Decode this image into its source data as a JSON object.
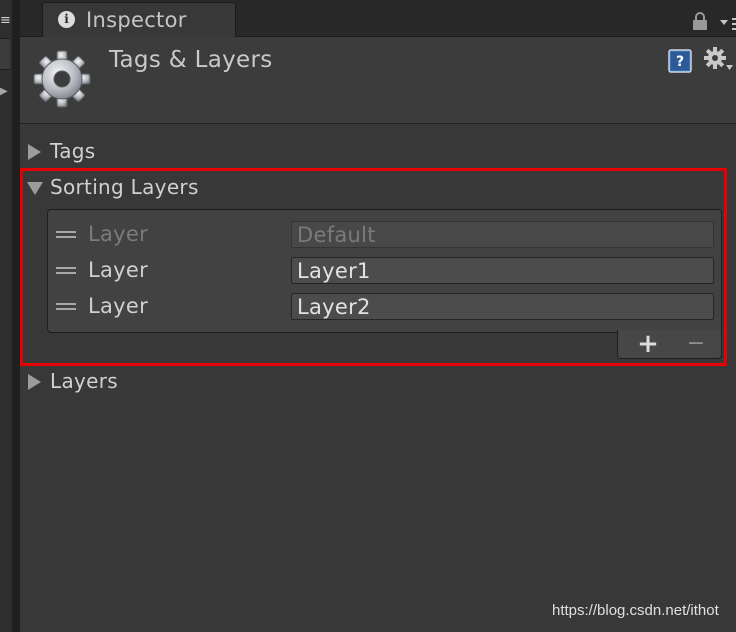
{
  "tab": {
    "title": "Inspector",
    "info_glyph": "i"
  },
  "header": {
    "title": "Tags & Layers"
  },
  "foldouts": {
    "tags": {
      "label": "Tags",
      "expanded": false
    },
    "sorting_layers": {
      "label": "Sorting Layers",
      "expanded": true
    },
    "layers": {
      "label": "Layers",
      "expanded": false
    }
  },
  "sorting_layers": {
    "items": [
      {
        "label": "Layer",
        "value": "Default",
        "disabled": true
      },
      {
        "label": "Layer",
        "value": "Layer1",
        "disabled": false
      },
      {
        "label": "Layer",
        "value": "Layer2",
        "disabled": false
      }
    ],
    "add_glyph": "+",
    "remove_glyph": "−"
  },
  "left_strip": {
    "menu_glyph": "≡",
    "arrow_glyph": "▶"
  },
  "icons": {
    "info": "info-icon",
    "lock": "lock-icon",
    "tab_menu": "tab-menu-icon",
    "gear": "gear-icon",
    "help": "help-icon",
    "settings": "settings-icon",
    "drag_handle": "drag-handle-icon"
  },
  "colors": {
    "highlight": "#e80000",
    "background": "#383838",
    "help_icon": "#3a6fb0"
  },
  "watermark": "https://blog.csdn.net/ithot"
}
